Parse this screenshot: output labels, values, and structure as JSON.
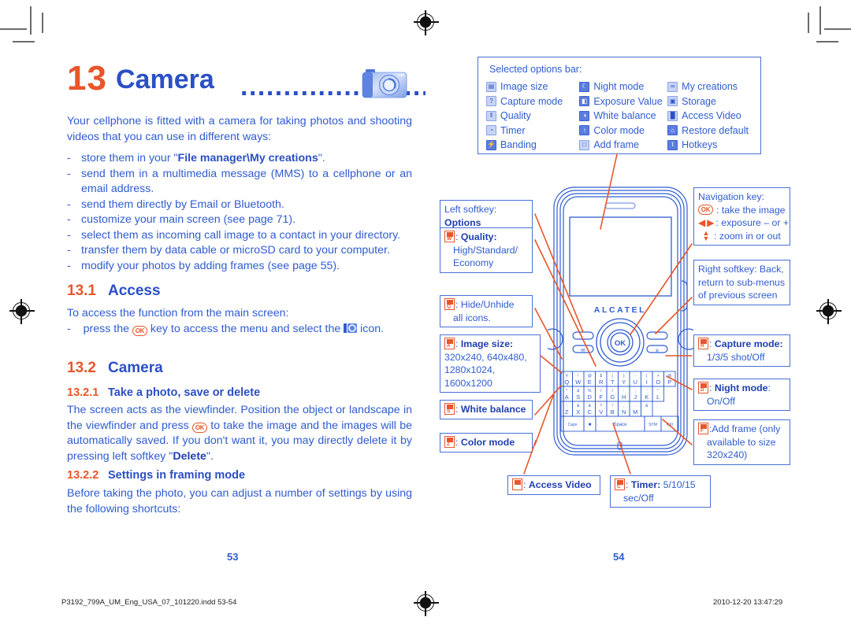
{
  "document": {
    "footer_file": "P3192_799A_UM_Eng_USA_07_101220.indd   53-54",
    "footer_date": "2010-12-20   13:47:29"
  },
  "left_page": {
    "page_number": "53",
    "chapter": {
      "number": "13",
      "title": "Camera",
      "dots": "........................",
      "icon": "camera-icon"
    },
    "intro": "Your cellphone is fitted with a camera for taking photos and shooting videos that you can use in different ways:",
    "bullets": [
      {
        "dash": "-",
        "pre": "store them in your \"",
        "bold": "File manager\\My creations",
        "post": "\"."
      },
      {
        "dash": "-",
        "pre": "send them in a multimedia message (MMS) to a cellphone or an email address.",
        "bold": "",
        "post": ""
      },
      {
        "dash": "-",
        "pre": "send them directly by Email or Bluetooth.",
        "bold": "",
        "post": ""
      },
      {
        "dash": "-",
        "pre": "customize your main screen (see page 71).",
        "bold": "",
        "post": ""
      },
      {
        "dash": "-",
        "pre": "select them as incoming call image to a contact in your directory.",
        "bold": "",
        "post": ""
      },
      {
        "dash": "-",
        "pre": "transfer them by data cable or microSD card to your computer.",
        "bold": "",
        "post": ""
      },
      {
        "dash": "-",
        "pre": "modify your photos by adding frames (see page 55).",
        "bold": "",
        "post": ""
      }
    ],
    "section_access": {
      "number": "13.1",
      "title": "Access",
      "intro": "To access the function from the main screen:",
      "bullet_dash": "-",
      "bullet_pre": "press the",
      "bullet_mid": "key to access the menu and select the",
      "bullet_post": "icon.",
      "ok_key_label": "OK"
    },
    "section_camera": {
      "number": "13.2",
      "title": "Camera",
      "sub1": {
        "number": "13.2.1",
        "title": "Take a photo, save or delete",
        "body_a": "The screen acts as the viewfinder. Position the object or landscape in the viewfinder and press",
        "body_b": "to take the image and the images will be automatically saved. If you don't want it, you may directly delete it by pressing left softkey \"",
        "body_bold": "Delete",
        "body_c": "\"."
      },
      "sub2": {
        "number": "13.2.2",
        "title": "Settings in framing mode",
        "body": "Before taking the photo, you can adjust a number of settings by using the following shortcuts:"
      }
    }
  },
  "right_page": {
    "page_number": "54",
    "options_bar": {
      "caption": "Selected options bar:",
      "columns": [
        [
          {
            "icon": "image-size-icon",
            "label": "Image size",
            "glyph": "▤",
            "style": "light"
          },
          {
            "icon": "capture-mode-icon",
            "label": "Capture mode",
            "glyph": "?",
            "style": "light"
          },
          {
            "icon": "quality-icon",
            "label": "Quality",
            "glyph": "‖",
            "style": "light"
          },
          {
            "icon": "timer-icon",
            "label": "Timer",
            "glyph": "◔",
            "style": "light"
          },
          {
            "icon": "banding-icon",
            "label": "Banding",
            "glyph": "⚡",
            "style": "solid"
          }
        ],
        [
          {
            "icon": "night-mode-icon",
            "label": "Night mode",
            "glyph": "☾",
            "style": "solid"
          },
          {
            "icon": "exposure-value-icon",
            "label": "Exposure Value",
            "glyph": "◧",
            "style": "solid"
          },
          {
            "icon": "white-balance-icon",
            "label": "White balance",
            "glyph": "◑",
            "style": "solid"
          },
          {
            "icon": "color-mode-icon",
            "label": "Color mode",
            "glyph": "↑",
            "style": "solid"
          },
          {
            "icon": "add-frame-icon",
            "label": "Add frame",
            "glyph": "□",
            "style": "light"
          }
        ],
        [
          {
            "icon": "my-creations-icon",
            "label": "My creations",
            "glyph": "∞",
            "style": "light"
          },
          {
            "icon": "storage-icon",
            "label": "Storage",
            "glyph": "▣",
            "style": "light"
          },
          {
            "icon": "access-video-icon",
            "label": "Access Video",
            "glyph": "█",
            "style": "light"
          },
          {
            "icon": "restore-default-icon",
            "label": "Restore default",
            "glyph": "⌂",
            "style": "solid"
          },
          {
            "icon": "hotkeys-icon",
            "label": "Hotkeys",
            "glyph": "t",
            "style": "solid"
          }
        ]
      ]
    },
    "phone": {
      "brand": "ALCATEL",
      "ok_key": "OK",
      "keyboard_rows": [
        [
          "#\nQ",
          "!\nW",
          "@\nE",
          "$\nR",
          "(\nT",
          ")\nY",
          "-\nU",
          "|\nI",
          "+\nO",
          "@\nP"
        ],
        [
          "*\nA",
          "&\nS",
          "%\nD",
          "/\nF",
          "/\nG",
          ":\nH",
          ";\nJ",
          "'\nK",
          "\"\nL"
        ],
        [
          "↑\nZ",
          "&\nX",
          "&\nC",
          "?\nV",
          "!\nB",
          ",\nN",
          ".\nM",
          "&"
        ]
      ],
      "space_label": "Space",
      "caps_label": "Caps",
      "sym_label": "SYM\nLg",
      "ctrl_label": "Ctrl"
    },
    "callouts_left": [
      {
        "name": "left-softkey-callout",
        "pre": "Left softkey: ",
        "bold": "Options",
        "lines": []
      },
      {
        "name": "quality-callout",
        "key_top": "!",
        "key_bot": "W",
        "pre": ": ",
        "bold": "Quality:",
        "lines": [
          "High/Standard/",
          "Economy"
        ]
      },
      {
        "name": "hide-unhide-callout",
        "key_top": "#",
        "key_bot": "Q",
        "pre": ": Hide/Unhide",
        "bold": "",
        "lines": [
          "all icons."
        ]
      },
      {
        "name": "image-size-callout",
        "key_top": "*",
        "key_bot": "A",
        "pre": ": ",
        "bold": "Image size:",
        "lines": [
          "320x240, 640x480,",
          "1280x1024, 1600x1200"
        ]
      },
      {
        "name": "white-balance-callout",
        "key_top": "&",
        "key_bot": "S",
        "pre": ": ",
        "bold": "White balance",
        "lines": []
      },
      {
        "name": "color-mode-callout",
        "key_top": "%",
        "key_bot": "Z",
        "pre": ": ",
        "bold": "Color mode",
        "lines": []
      }
    ],
    "callouts_bottom": [
      {
        "name": "access-video-callout",
        "key_top": "■",
        "key_bot": "",
        "pre": ": ",
        "bold": "Access Video",
        "lines": []
      },
      {
        "name": "timer-callout",
        "key_top": "@",
        "key_bot": "C",
        "pre": ": ",
        "bold": "Timer:",
        "post": " 5/10/15",
        "lines": [
          "sec/Off"
        ]
      }
    ],
    "callouts_right": [
      {
        "name": "navigation-key-callout",
        "title": "Navigation key:",
        "rows": [
          {
            "glyph": "ok",
            "text": ": take the image"
          },
          {
            "glyph": "leftright",
            "text": ": exposure – or +"
          },
          {
            "glyph": "updown",
            "text": ": zoom in or out"
          }
        ]
      },
      {
        "name": "right-softkey-callout",
        "lines": [
          "Right softkey: Back,",
          "return to sub-menus",
          "of previous screen"
        ]
      },
      {
        "name": "capture-mode-callout",
        "key_top": "@",
        "key_bot": "R",
        "pre": ": ",
        "bold": "Capture mode:",
        "lines": [
          "1/3/5 shot/Off"
        ]
      },
      {
        "name": "night-mode-callout",
        "key_top": "&",
        "key_bot": "D",
        "pre": ": ",
        "bold": "Night mode",
        "post": ":",
        "lines": [
          "On/Off"
        ]
      },
      {
        "name": "add-frame-callout",
        "key_top": "/",
        "key_bot": "F",
        "pre": ":Add frame (only",
        "bold": "",
        "lines": [
          "available to size",
          "320x240)"
        ]
      }
    ]
  }
}
